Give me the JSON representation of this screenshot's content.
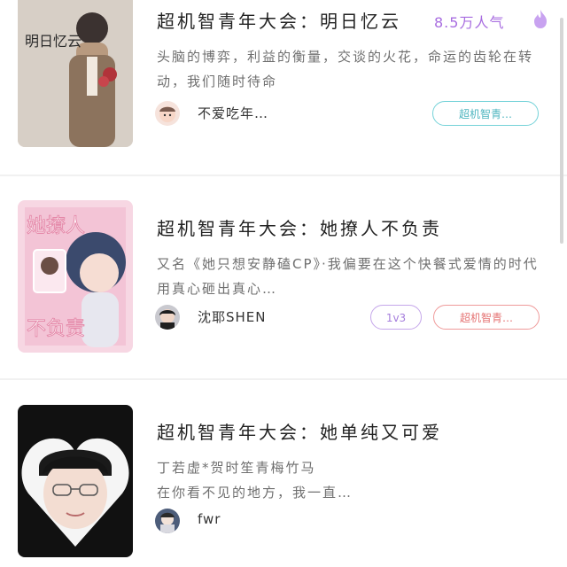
{
  "cards": [
    {
      "title": "超机智青年大会：明日忆云",
      "popularity": "8.5万人气",
      "description": "头脑的博弈，利益的衡量，交谈的火花，命运的齿轮在转动，我们随时待命",
      "author": "不爱吃年…",
      "tags": [
        "超机智青…"
      ]
    },
    {
      "title": "超机智青年大会：她撩人不负责",
      "description": "又名《她只想安静磕CP》·我偏要在这个快餐式爱情的时代用真心砸出真心…",
      "author": "沈耶SHEN",
      "tags": [
        "1v3",
        "超机智青…"
      ]
    },
    {
      "title": "超机智青年大会：她单纯又可爱",
      "description_lines": [
        "丁若虚*贺时笙青梅竹马",
        "在你看不见的地方，我一直…"
      ],
      "author": "fwr",
      "tags": []
    }
  ],
  "colors": {
    "popularity": "#a86de0",
    "tag_teal": "#4fb6c0",
    "tag_purple": "#a57ddc",
    "tag_pink": "#e57373"
  },
  "icons": [
    "flame-icon"
  ],
  "cover_text": {
    "card1": "明日忆云",
    "card2_top": "她撩人",
    "card2_bottom": "不负责"
  }
}
